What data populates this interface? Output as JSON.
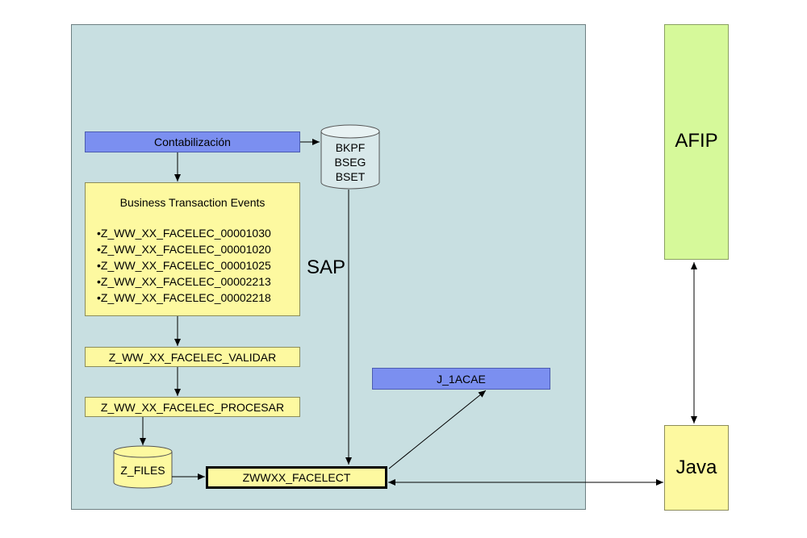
{
  "diagram": {
    "contabilizacion": "Contabilización",
    "bte_title": "Business Transaction Events",
    "bte_items": [
      "•Z_WW_XX_FACELEC_00001030",
      "•Z_WW_XX_FACELEC_00001020",
      "•Z_WW_XX_FACELEC_00001025",
      "•Z_WW_XX_FACELEC_00002213",
      "•Z_WW_XX_FACELEC_00002218"
    ],
    "validar": "Z_WW_XX_FACELEC_VALIDAR",
    "procesar": "Z_WW_XX_FACELEC_PROCESAR",
    "z_files": "Z_FILES",
    "db_tables": [
      "BKPF",
      "BSEG",
      "BSET"
    ],
    "sap": "SAP",
    "j_1acae": "J_1ACAE",
    "facelect": "ZWWXX_FACELECT",
    "afip": "AFIP",
    "java": "Java"
  },
  "colors": {
    "sap_area": "#c8dfe1",
    "blue_box": "#7b8ff0",
    "yellow_box": "#fdf9a0",
    "green_box": "#d6f99a"
  }
}
